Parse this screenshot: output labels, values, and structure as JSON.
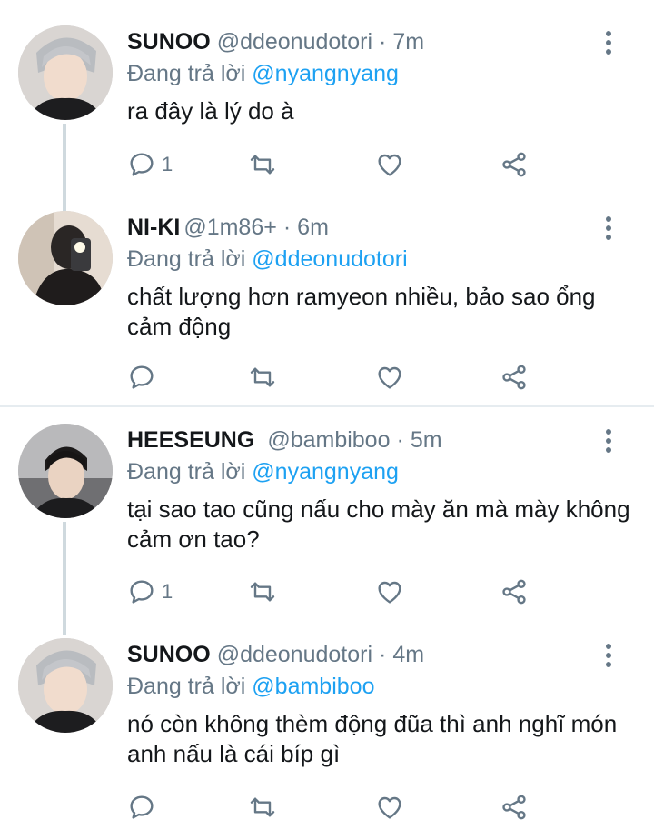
{
  "tweets": [
    {
      "name": "SUNOO",
      "handle": "@ddeonudotori",
      "time": "7m",
      "reply_prefix": "Đang trả lời",
      "reply_to": "@nyangnyang",
      "text": "ra đây là lý do à",
      "reply_count": "1",
      "avatar": "avatar-sunoo"
    },
    {
      "name": "NI-KI",
      "handle": "@1m86+",
      "time": "6m",
      "reply_prefix": "Đang trả lời",
      "reply_to": "@ddeonudotori",
      "text": "chất lượng hơn ramyeon nhiều, bảo sao ổng cảm động",
      "reply_count": "",
      "avatar": "avatar-niki"
    },
    {
      "name": "HEESEUNG",
      "handle": "@bambiboo",
      "time": "5m",
      "reply_prefix": "Đang trả lời",
      "reply_to": "@nyangnyang",
      "text": "tại sao tao cũng nấu cho mày ăn mà mày không cảm ơn tao?",
      "reply_count": "1",
      "avatar": "avatar-heeseung"
    },
    {
      "name": "SUNOO",
      "handle": "@ddeonudotori",
      "time": "4m",
      "reply_prefix": "Đang trả lời",
      "reply_to": "@bambiboo",
      "text": "nó còn không thèm động đũa thì anh nghĩ món anh nấu là cái bíp gì",
      "reply_count": "",
      "avatar": "avatar-sunoo"
    }
  ],
  "dot": "·",
  "colors": {
    "accent": "#1da1f2",
    "muted": "#657786",
    "text": "#14171a",
    "thread": "#cfd9de"
  },
  "icons": [
    "reply-icon",
    "retweet-icon",
    "like-icon",
    "share-icon",
    "more-icon"
  ]
}
